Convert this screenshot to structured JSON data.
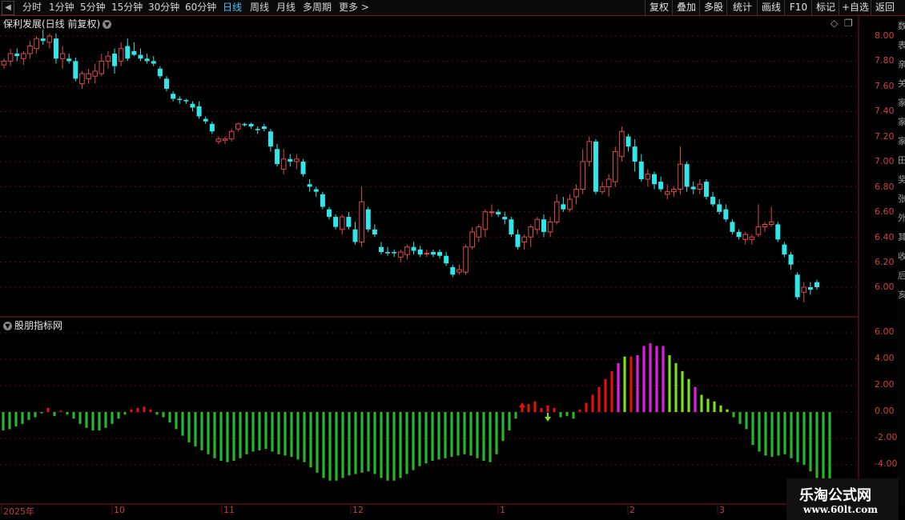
{
  "toolbar": {
    "periods": [
      "分时",
      "1分钟",
      "5分钟",
      "15分钟",
      "30分钟",
      "60分钟",
      "日线",
      "周线",
      "月线",
      "多周期",
      "更多"
    ],
    "active_period": "日线",
    "more_arrow": ">",
    "buttons": [
      "复权",
      "叠加",
      "多股",
      "统计",
      "画线",
      "F10",
      "标记",
      "+自选",
      "返回"
    ]
  },
  "chart_title": "保利发展(日线 前复权)",
  "title_menu_icon": "chevron-down-icon",
  "sub_title": "股朋指标网",
  "right_strip_chars": [
    "数",
    "表",
    "亲",
    "关",
    "家",
    "家",
    "家",
    "田",
    "奖",
    "张",
    "外",
    "其",
    "收",
    "后",
    "亥"
  ],
  "colors": {
    "up": "#e04a4a",
    "down": "#2fe6ea",
    "pos_bar": "#e01010",
    "pos_bar_alt": "#7be01c",
    "magenta": "#e020e0",
    "neg_bar": "#2bb22b",
    "grid": "#5a1010",
    "axis": "#d04040"
  },
  "price_axis": [
    "8.00",
    "7.80",
    "7.60",
    "7.40",
    "7.20",
    "7.00",
    "6.80",
    "6.60",
    "6.40",
    "6.20",
    "6.00"
  ],
  "ind_axis": [
    "6.00",
    "4.00",
    "2.00",
    "0.00",
    "-2.00",
    "-4.00"
  ],
  "date_axis": [
    "2025年",
    "10",
    "11",
    "12",
    "1",
    "2",
    "3"
  ],
  "watermark": {
    "line1": "乐淘公式网",
    "line2": "www.60lt.com"
  },
  "chart_data": [
    {
      "type": "candlestick",
      "title": "保利发展(日线 前复权)",
      "ylim": [
        5.9,
        8.05
      ],
      "ohlc": [
        [
          7.77,
          7.82,
          7.74,
          7.8
        ],
        [
          7.8,
          7.9,
          7.76,
          7.86
        ],
        [
          7.86,
          7.9,
          7.8,
          7.84
        ],
        [
          7.82,
          7.88,
          7.77,
          7.86
        ],
        [
          7.86,
          7.96,
          7.82,
          7.92
        ],
        [
          7.9,
          8.0,
          7.86,
          7.98
        ],
        [
          7.98,
          8.05,
          7.93,
          7.96
        ],
        [
          7.95,
          8.02,
          7.9,
          8.0
        ],
        [
          7.98,
          8.02,
          7.78,
          7.82
        ],
        [
          7.82,
          7.92,
          7.74,
          7.86
        ],
        [
          7.82,
          7.86,
          7.78,
          7.8
        ],
        [
          7.8,
          7.83,
          7.64,
          7.66
        ],
        [
          7.62,
          7.72,
          7.58,
          7.7
        ],
        [
          7.66,
          7.74,
          7.62,
          7.7
        ],
        [
          7.68,
          7.78,
          7.62,
          7.72
        ],
        [
          7.7,
          7.86,
          7.68,
          7.8
        ],
        [
          7.8,
          7.88,
          7.74,
          7.84
        ],
        [
          7.86,
          7.9,
          7.7,
          7.76
        ],
        [
          7.8,
          7.95,
          7.76,
          7.9
        ],
        [
          7.92,
          7.98,
          7.8,
          7.82
        ],
        [
          7.88,
          7.95,
          7.84,
          7.85
        ],
        [
          7.85,
          7.9,
          7.8,
          7.82
        ],
        [
          7.82,
          7.86,
          7.78,
          7.8
        ],
        [
          7.8,
          7.84,
          7.76,
          7.78
        ],
        [
          7.74,
          7.76,
          7.66,
          7.68
        ],
        [
          7.66,
          7.68,
          7.56,
          7.58
        ],
        [
          7.54,
          7.56,
          7.48,
          7.5
        ],
        [
          7.5,
          7.52,
          7.46,
          7.49
        ],
        [
          7.49,
          7.5,
          7.46,
          7.48
        ],
        [
          7.46,
          7.48,
          7.4,
          7.43
        ],
        [
          7.44,
          7.48,
          7.34,
          7.36
        ],
        [
          7.34,
          7.36,
          7.3,
          7.32
        ],
        [
          7.3,
          7.32,
          7.22,
          7.24
        ],
        [
          7.16,
          7.2,
          7.14,
          7.18
        ],
        [
          7.17,
          7.2,
          7.14,
          7.18
        ],
        [
          7.18,
          7.26,
          7.16,
          7.24
        ],
        [
          7.26,
          7.31,
          7.24,
          7.3
        ],
        [
          7.3,
          7.31,
          7.28,
          7.29
        ],
        [
          7.3,
          7.31,
          7.26,
          7.28
        ],
        [
          7.26,
          7.28,
          7.22,
          7.25
        ],
        [
          7.28,
          7.3,
          7.24,
          7.26
        ],
        [
          7.24,
          7.26,
          7.08,
          7.12
        ],
        [
          7.1,
          7.14,
          6.96,
          6.98
        ],
        [
          6.94,
          7.1,
          6.9,
          7.02
        ],
        [
          7.02,
          7.06,
          6.96,
          7.0
        ],
        [
          7.0,
          7.06,
          6.94,
          7.02
        ],
        [
          7.0,
          7.02,
          6.88,
          6.9
        ],
        [
          6.82,
          6.86,
          6.76,
          6.8
        ],
        [
          6.78,
          6.8,
          6.72,
          6.76
        ],
        [
          6.74,
          6.76,
          6.62,
          6.64
        ],
        [
          6.62,
          6.64,
          6.54,
          6.56
        ],
        [
          6.56,
          6.58,
          6.46,
          6.48
        ],
        [
          6.46,
          6.58,
          6.42,
          6.56
        ],
        [
          6.56,
          6.6,
          6.46,
          6.48
        ],
        [
          6.46,
          6.52,
          6.34,
          6.36
        ],
        [
          6.36,
          6.8,
          6.32,
          6.68
        ],
        [
          6.62,
          6.64,
          6.44,
          6.46
        ],
        [
          6.46,
          6.5,
          6.4,
          6.42
        ],
        [
          6.32,
          6.36,
          6.26,
          6.28
        ],
        [
          6.28,
          6.32,
          6.25,
          6.27
        ],
        [
          6.28,
          6.3,
          6.24,
          6.27
        ],
        [
          6.24,
          6.3,
          6.2,
          6.28
        ],
        [
          6.26,
          6.34,
          6.22,
          6.32
        ],
        [
          6.32,
          6.36,
          6.26,
          6.29
        ],
        [
          6.3,
          6.33,
          6.24,
          6.26
        ],
        [
          6.27,
          6.3,
          6.24,
          6.27
        ],
        [
          6.28,
          6.3,
          6.24,
          6.26
        ],
        [
          6.28,
          6.3,
          6.23,
          6.25
        ],
        [
          6.25,
          6.28,
          6.17,
          6.19
        ],
        [
          6.16,
          6.18,
          6.08,
          6.1
        ],
        [
          6.12,
          6.18,
          6.1,
          6.14
        ],
        [
          6.12,
          6.34,
          6.1,
          6.32
        ],
        [
          6.32,
          6.48,
          6.3,
          6.44
        ],
        [
          6.4,
          6.5,
          6.36,
          6.48
        ],
        [
          6.46,
          6.62,
          6.4,
          6.6
        ],
        [
          6.6,
          6.66,
          6.56,
          6.6
        ],
        [
          6.6,
          6.62,
          6.56,
          6.58
        ],
        [
          6.56,
          6.6,
          6.5,
          6.54
        ],
        [
          6.54,
          6.56,
          6.4,
          6.42
        ],
        [
          6.42,
          6.46,
          6.3,
          6.32
        ],
        [
          6.36,
          6.42,
          6.3,
          6.4
        ],
        [
          6.4,
          6.5,
          6.32,
          6.48
        ],
        [
          6.46,
          6.56,
          6.42,
          6.54
        ],
        [
          6.54,
          6.58,
          6.4,
          6.44
        ],
        [
          6.44,
          6.56,
          6.4,
          6.52
        ],
        [
          6.52,
          6.74,
          6.5,
          6.68
        ],
        [
          6.66,
          6.72,
          6.6,
          6.62
        ],
        [
          6.62,
          6.74,
          6.6,
          6.7
        ],
        [
          6.72,
          6.82,
          6.66,
          6.78
        ],
        [
          6.78,
          7.1,
          6.74,
          7.0
        ],
        [
          7.0,
          7.2,
          6.96,
          7.16
        ],
        [
          7.16,
          7.18,
          6.74,
          6.76
        ],
        [
          6.76,
          6.84,
          6.74,
          6.8
        ],
        [
          6.8,
          6.9,
          6.72,
          6.86
        ],
        [
          6.84,
          7.12,
          6.8,
          7.08
        ],
        [
          7.04,
          7.28,
          7.0,
          7.24
        ],
        [
          7.2,
          7.22,
          7.08,
          7.12
        ],
        [
          7.12,
          7.18,
          6.92,
          7.0
        ],
        [
          7.0,
          7.06,
          6.84,
          6.86
        ],
        [
          6.86,
          6.94,
          6.8,
          6.9
        ],
        [
          6.9,
          6.92,
          6.78,
          6.82
        ],
        [
          6.84,
          6.88,
          6.76,
          6.78
        ],
        [
          6.74,
          6.82,
          6.7,
          6.76
        ],
        [
          6.76,
          6.8,
          6.72,
          6.78
        ],
        [
          6.78,
          7.12,
          6.74,
          6.98
        ],
        [
          6.98,
          7.0,
          6.76,
          6.8
        ],
        [
          6.8,
          6.84,
          6.74,
          6.78
        ],
        [
          6.78,
          6.86,
          6.74,
          6.82
        ],
        [
          6.84,
          6.86,
          6.7,
          6.72
        ],
        [
          6.72,
          6.76,
          6.64,
          6.66
        ],
        [
          6.66,
          6.7,
          6.58,
          6.6
        ],
        [
          6.62,
          6.66,
          6.52,
          6.54
        ],
        [
          6.52,
          6.54,
          6.42,
          6.44
        ],
        [
          6.44,
          6.46,
          6.38,
          6.4
        ],
        [
          6.38,
          6.44,
          6.34,
          6.42
        ],
        [
          6.38,
          6.42,
          6.34,
          6.4
        ],
        [
          6.42,
          6.66,
          6.4,
          6.48
        ],
        [
          6.48,
          6.52,
          6.44,
          6.5
        ],
        [
          6.5,
          6.64,
          6.48,
          6.52
        ],
        [
          6.5,
          6.52,
          6.36,
          6.38
        ],
        [
          6.34,
          6.36,
          6.24,
          6.26
        ],
        [
          6.26,
          6.28,
          6.14,
          6.18
        ],
        [
          6.1,
          6.12,
          5.9,
          5.92
        ],
        [
          5.96,
          6.04,
          5.88,
          6.0
        ],
        [
          6.0,
          6.04,
          5.94,
          5.98
        ],
        [
          6.04,
          6.06,
          5.98,
          6.0
        ]
      ]
    },
    {
      "type": "bar",
      "title": "股朋指标网",
      "ylim": [
        -5.2,
        7.0
      ],
      "values": [
        -1.4,
        -1.3,
        -1.1,
        -0.9,
        -0.6,
        -0.4,
        -0.1,
        0.3,
        -0.3,
        0.1,
        -0.2,
        -0.5,
        -0.9,
        -1.2,
        -1.4,
        -1.4,
        -1.2,
        -0.9,
        -0.5,
        -0.2,
        0.2,
        0.3,
        0.4,
        0.2,
        -0.2,
        -0.4,
        -0.8,
        -1.3,
        -1.8,
        -2.3,
        -2.6,
        -2.9,
        -3.2,
        -3.5,
        -3.7,
        -3.8,
        -3.7,
        -3.5,
        -3.2,
        -3.0,
        -2.9,
        -2.8,
        -3.0,
        -3.2,
        -3.3,
        -3.4,
        -3.6,
        -3.8,
        -4.2,
        -4.6,
        -5.0,
        -5.2,
        -5.2,
        -5.0,
        -4.8,
        -4.7,
        -4.6,
        -4.5,
        -4.7,
        -5.0,
        -5.2,
        -5.2,
        -5.0,
        -4.7,
        -4.4,
        -4.1,
        -3.9,
        -3.7,
        -3.6,
        -3.5,
        -3.4,
        -3.3,
        -3.2,
        -3.3,
        -3.5,
        -3.7,
        -3.8,
        -3.2,
        -2.2,
        -1.4,
        -0.5,
        0.4,
        0.6,
        0.8,
        0.3,
        0.5,
        0.3,
        -0.4,
        -0.3,
        -0.5,
        0.2,
        0.7,
        1.3,
        1.9,
        2.5,
        3.1,
        3.7,
        4.2,
        4.2,
        4.3,
        5.0,
        5.2,
        5.0,
        5.0,
        4.3,
        3.7,
        3.1,
        2.5,
        1.9,
        1.3,
        1.0,
        0.8,
        0.5,
        0.2,
        -0.4,
        -0.9,
        -1.3,
        -2.5,
        -3.0,
        -3.3,
        -3.4,
        -3.3,
        -3.2,
        -3.5,
        -3.8,
        -4.0,
        -4.5,
        -5.0,
        -5.2,
        -5.2
      ]
    }
  ]
}
